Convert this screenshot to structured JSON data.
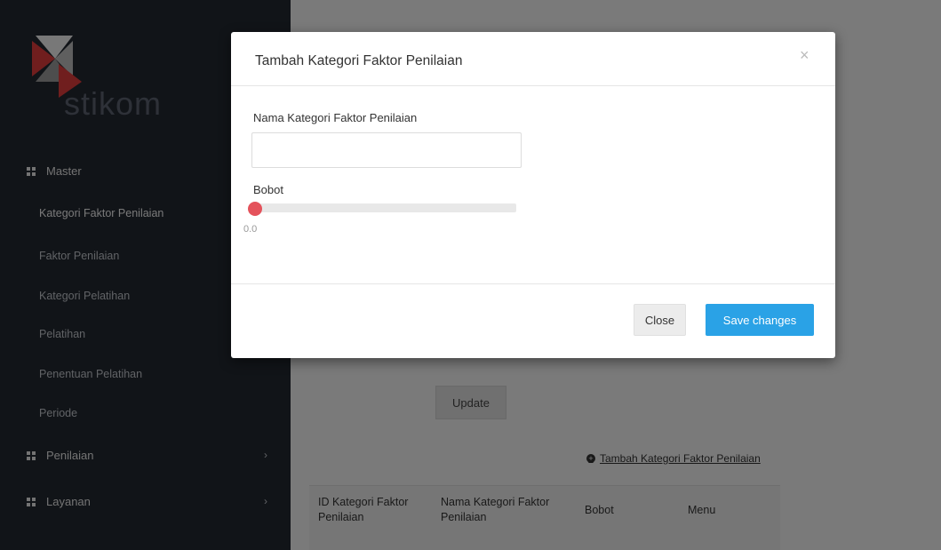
{
  "brand": {
    "logo_text": "stikom"
  },
  "sidebar": {
    "sections": [
      {
        "label": "Master"
      },
      {
        "label": "Penilaian"
      },
      {
        "label": "Layanan"
      }
    ],
    "master_items": [
      {
        "label": "Kategori Faktor Penilaian"
      },
      {
        "label": "Faktor Penilaian"
      },
      {
        "label": "Kategori Pelatihan"
      },
      {
        "label": "Pelatihan"
      },
      {
        "label": "Penentuan Pelatihan"
      },
      {
        "label": "Periode"
      }
    ]
  },
  "content": {
    "update_label": "Update",
    "add_link_label": "Tambah Kategori Faktor Penilaian",
    "table_headers": [
      "ID Kategori Faktor Penilaian",
      "Nama Kategori Faktor Penilaian",
      "Bobot",
      "Menu"
    ]
  },
  "modal": {
    "title": "Tambah Kategori Faktor Penilaian",
    "close_glyph": "×",
    "field_nama_label": "Nama Kategori Faktor Penilaian",
    "field_nama_value": "",
    "field_bobot_label": "Bobot",
    "bobot_value": "0.0",
    "close_label": "Close",
    "save_label": "Save changes"
  },
  "colors": {
    "sidebar_bg": "#232831",
    "accent": "#2aa2e6",
    "slider_handle": "#e4525b"
  },
  "icons": {
    "logo": "stikom-logo-icon",
    "section": "grid-icon",
    "chevron": "chevron-right-icon",
    "add": "plus-circle-icon",
    "close": "close-icon"
  }
}
